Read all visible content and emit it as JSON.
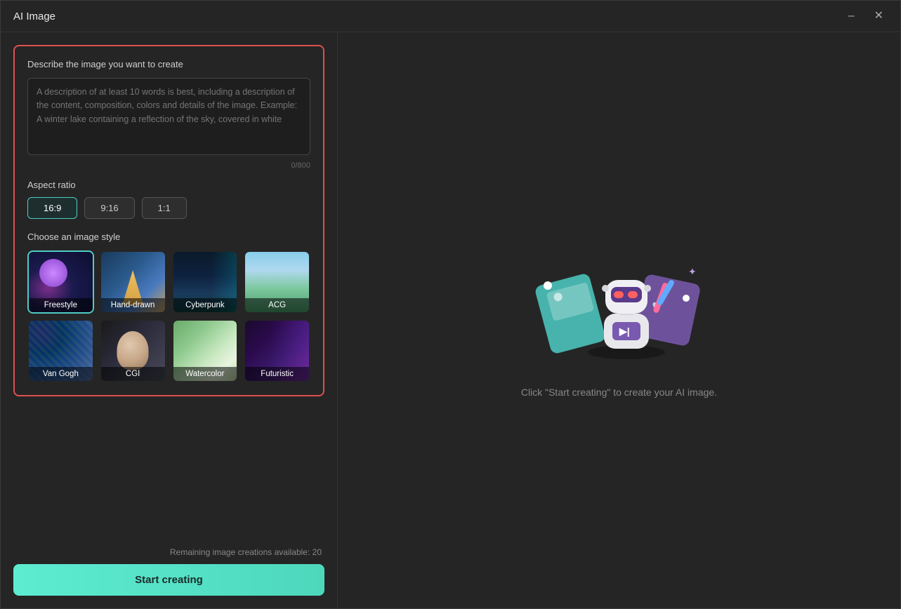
{
  "window": {
    "title": "AI Image",
    "minimize_label": "minimize",
    "close_label": "close"
  },
  "left": {
    "describe_label": "Describe the image you want to create",
    "textarea_placeholder": "A description of at least 10 words is best, including a description of the content, composition, colors and details of the image. Example: A winter lake containing a reflection of the sky, covered in white",
    "char_count": "0/800",
    "aspect_label": "Aspect ratio",
    "aspect_options": [
      {
        "label": "16:9",
        "active": true
      },
      {
        "label": "9:16",
        "active": false
      },
      {
        "label": "1:1",
        "active": false
      }
    ],
    "style_label": "Choose an image style",
    "styles": [
      {
        "id": "freestyle",
        "name": "Freestyle",
        "selected": true
      },
      {
        "id": "hand-drawn",
        "name": "Hand-drawn",
        "selected": false
      },
      {
        "id": "cyberpunk",
        "name": "Cyberpunk",
        "selected": false
      },
      {
        "id": "acg",
        "name": "ACG",
        "selected": false
      },
      {
        "id": "van-gogh",
        "name": "Van Gogh",
        "selected": false
      },
      {
        "id": "cgi",
        "name": "CGI",
        "selected": false
      },
      {
        "id": "watercolor",
        "name": "Watercolor",
        "selected": false
      },
      {
        "id": "futuristic",
        "name": "Futuristic",
        "selected": false
      }
    ],
    "remaining_text": "Remaining image creations available: 20",
    "start_btn_label": "Start creating"
  },
  "right": {
    "hint_text": "Click \"Start creating\" to create your AI image."
  }
}
